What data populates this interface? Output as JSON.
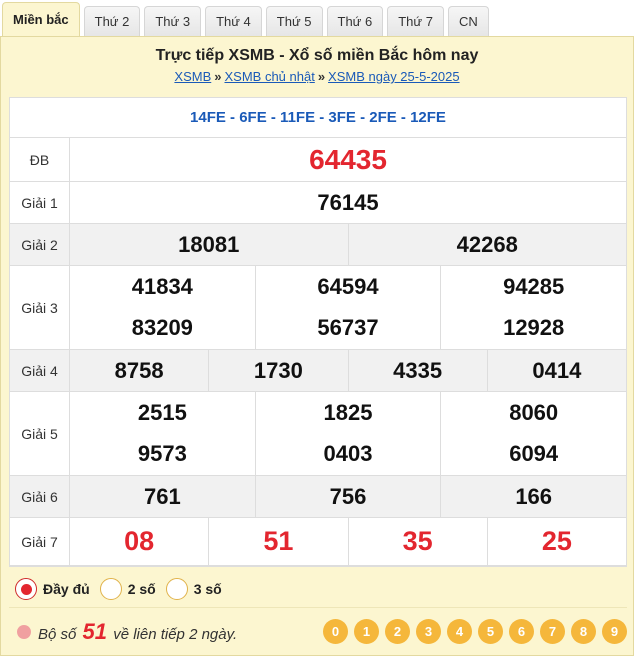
{
  "tabs": [
    "Miền bắc",
    "Thứ 2",
    "Thứ 3",
    "Thứ 4",
    "Thứ 5",
    "Thứ 6",
    "Thứ 7",
    "CN"
  ],
  "header": {
    "title": "Trực tiếp XSMB - Xổ số miền Bắc hôm nay",
    "breadcrumb": [
      "XSMB",
      "XSMB chủ nhật",
      "XSMB ngày 25-5-2025"
    ],
    "sep": "»"
  },
  "codes": "14FE - 6FE - 11FE - 3FE - 2FE - 12FE",
  "prizes": [
    {
      "label": "ĐB",
      "lines": [
        [
          "64435"
        ]
      ]
    },
    {
      "label": "Giải 1",
      "lines": [
        [
          "76145"
        ]
      ]
    },
    {
      "label": "Giải 2",
      "lines": [
        [
          "18081",
          "42268"
        ]
      ]
    },
    {
      "label": "Giải 3",
      "lines": [
        [
          "41834",
          "64594",
          "94285"
        ],
        [
          "83209",
          "56737",
          "12928"
        ]
      ]
    },
    {
      "label": "Giải 4",
      "lines": [
        [
          "8758",
          "1730",
          "4335",
          "0414"
        ]
      ]
    },
    {
      "label": "Giải 5",
      "lines": [
        [
          "2515",
          "1825",
          "8060"
        ],
        [
          "9573",
          "0403",
          "6094"
        ]
      ]
    },
    {
      "label": "Giải 6",
      "lines": [
        [
          "761",
          "756",
          "166"
        ]
      ]
    },
    {
      "label": "Giải 7",
      "lines": [
        [
          "08",
          "51",
          "35",
          "25"
        ]
      ]
    }
  ],
  "options": [
    {
      "label": "Đầy đủ",
      "selected": true
    },
    {
      "label": "2 số",
      "selected": false
    },
    {
      "label": "3 số",
      "selected": false
    }
  ],
  "note": {
    "prefix": "Bộ số",
    "number": "51",
    "suffix": "về liên tiếp 2 ngày."
  },
  "digits": [
    "0",
    "1",
    "2",
    "3",
    "4",
    "5",
    "6",
    "7",
    "8",
    "9"
  ]
}
